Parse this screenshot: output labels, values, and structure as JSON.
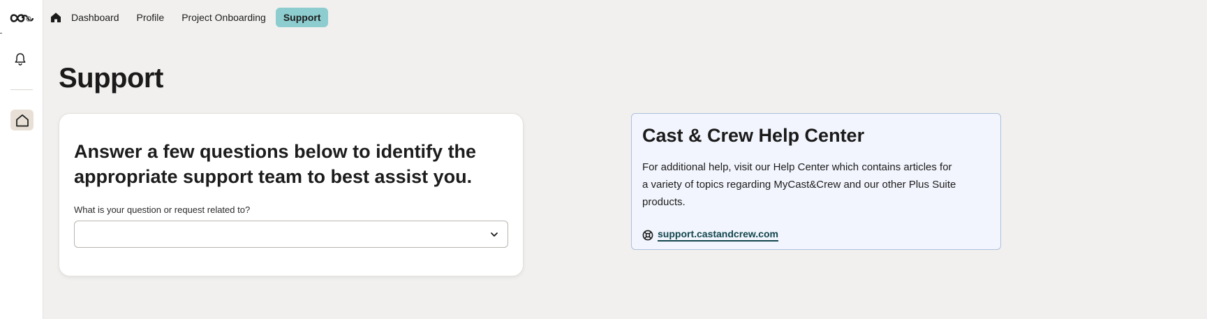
{
  "nav": {
    "items": [
      {
        "label": "Dashboard"
      },
      {
        "label": "Profile"
      },
      {
        "label": "Project Onboarding"
      },
      {
        "label": "Support",
        "active": true
      }
    ]
  },
  "page": {
    "title": "Support"
  },
  "support_form": {
    "heading": "Answer a few questions below to identify the appropriate support team to best assist you.",
    "question_label": "What is your question or request related to?",
    "question_value": ""
  },
  "help_center": {
    "title": "Cast & Crew Help Center",
    "description": "For additional help, visit our Help Center which contains articles for a variety of topics regarding MyCast&Crew and our other Plus Suite products.",
    "link_text": "support.castandcrew.com"
  },
  "colors": {
    "accent": "#8dcdd0",
    "link": "#12454d",
    "help_card_bg": "#f2f5fd",
    "help_card_border": "#aec0df",
    "page_bg": "#f1f0ee"
  },
  "icons": {
    "logo": "cast-and-crew-logo",
    "notifications": "bell-icon",
    "sidebar_home": "home-outline-icon",
    "nav_home": "home-filled-icon",
    "dropdown": "chevron-down-icon",
    "help_link": "lifebuoy-icon"
  }
}
